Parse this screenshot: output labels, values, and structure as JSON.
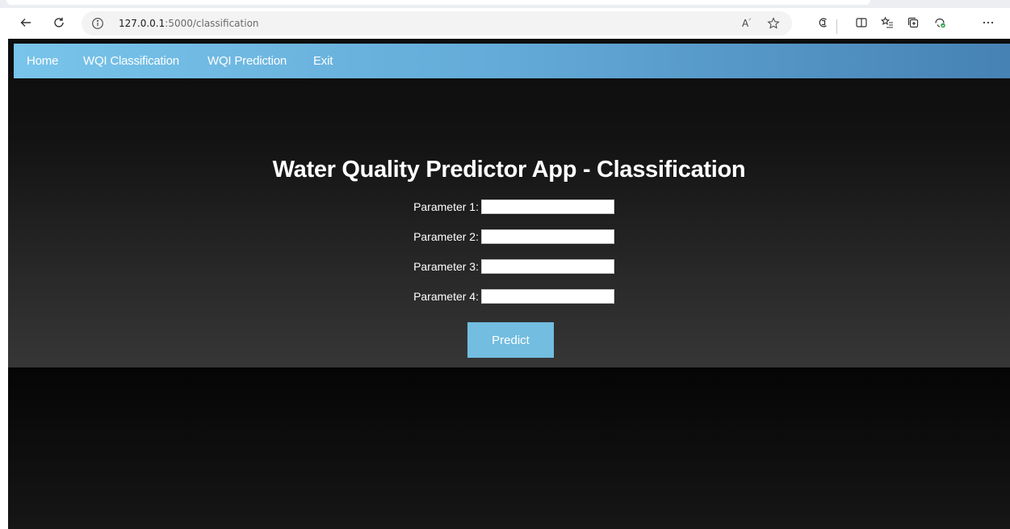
{
  "browser": {
    "address_host": "127.0.0.1",
    "address_path": ":5000/classification",
    "read_aloud_glyph": "A̅"
  },
  "nav": {
    "items": [
      "Home",
      "WQI Classification",
      "WQI Prediction",
      "Exit"
    ]
  },
  "page": {
    "title": "Water Quality Predictor App - Classification",
    "fields": [
      {
        "label": "Parameter 1:",
        "value": ""
      },
      {
        "label": "Parameter 2:",
        "value": ""
      },
      {
        "label": "Parameter 3:",
        "value": ""
      },
      {
        "label": "Parameter 4:",
        "value": ""
      }
    ],
    "submit_label": "Predict"
  },
  "icons": {
    "back": "back-arrow-icon",
    "refresh": "refresh-icon",
    "info": "info-icon",
    "read_aloud": "read-aloud-icon",
    "favorite": "star-icon",
    "copilot": "copilot-icon",
    "split_screen": "split-screen-icon",
    "favorites_bar": "favorites-icon",
    "collections": "collections-icon",
    "extensions": "extensions-icon",
    "more": "more-icon"
  },
  "colors": {
    "nav_start": "#78c4ea",
    "nav_end": "#4682b4",
    "button": "#72bde0",
    "page_background": "#2a2a2a"
  }
}
